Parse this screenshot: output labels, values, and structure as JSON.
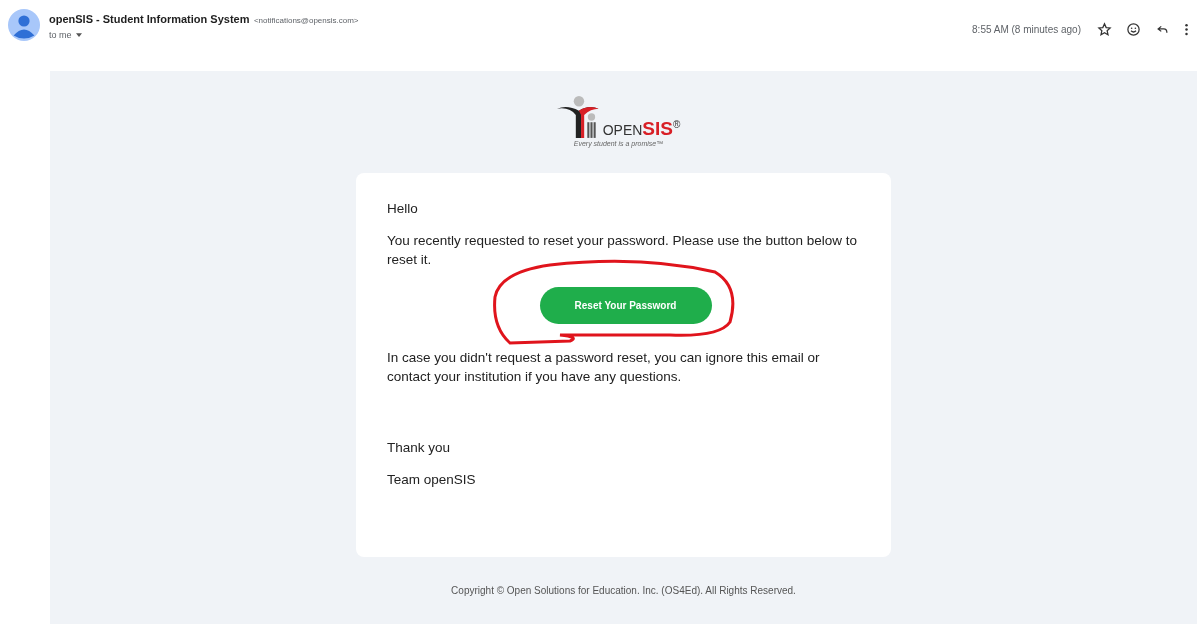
{
  "sender": {
    "name": "openSIS - Student Information System",
    "email": "<notifications@opensis.com>",
    "recipient": "to me"
  },
  "time": "8:55 AM (8 minutes ago)",
  "logo": {
    "word_plain": "OPEN",
    "word_accent": "SIS",
    "mark": "®",
    "tagline": "Every student is a promise™"
  },
  "message": {
    "greeting": "Hello",
    "intro": "You recently requested to reset your password. Please use the button below to reset it.",
    "button": "Reset Your Password",
    "note": "In case you didn't request a password reset, you can ignore this email or contact your institution if you have any questions.",
    "thanks": "Thank you",
    "signature": "Team openSIS"
  },
  "footer": "Copyright © Open Solutions for Education. Inc. (OS4Ed). All Rights Reserved."
}
